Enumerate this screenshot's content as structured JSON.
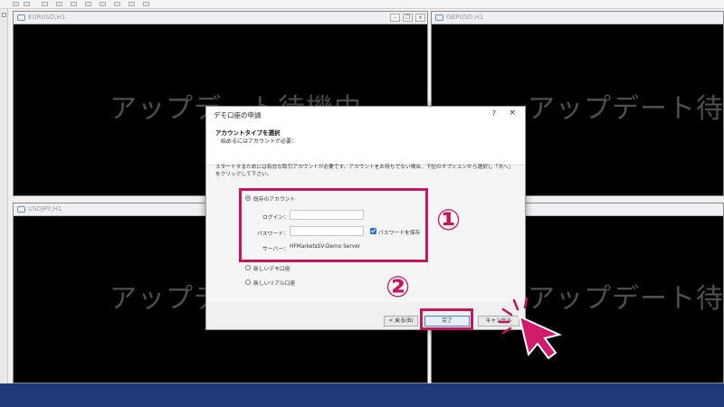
{
  "charts": {
    "tl": {
      "title": "EURUSD,H1",
      "message": "アップデート待機中"
    },
    "tr": {
      "title": "GBPUSD,H1",
      "message": "アップデート待機"
    },
    "bl": {
      "title": "USDJPY,H1",
      "message": "アップデート待機中"
    },
    "br": {
      "title": "",
      "message": "アップデート待機"
    }
  },
  "dialog": {
    "title": "デモ口座の申請",
    "help": "?",
    "close": "×",
    "header_title": "アカウントタイプを選択",
    "header_sub": "始めるにはアカウントが必要：",
    "instructions": "スタートするためには有効な取引アカウントが必要です。アカウントをお持ちでない場合、下記のオプションから選択し「次へ」をクリックして下さい。",
    "option_existing": "既存のアカウント",
    "login_label": "ログイン：",
    "login_value": "",
    "password_label": "パスワード：",
    "password_value": "",
    "save_password_label": "パスワードを保存",
    "server_label": "サーバー：",
    "server_value": "HFMarketsSV-Demo Server",
    "option_new_demo": "新しいデモ口座",
    "option_new_real": "新しいリアル口座",
    "back_button": "< 戻る(B)",
    "finish_button": "完了",
    "cancel_button": "キャンセル"
  },
  "annotations": {
    "step1": "①",
    "step2": "②",
    "accent_color": "#c0185a"
  }
}
